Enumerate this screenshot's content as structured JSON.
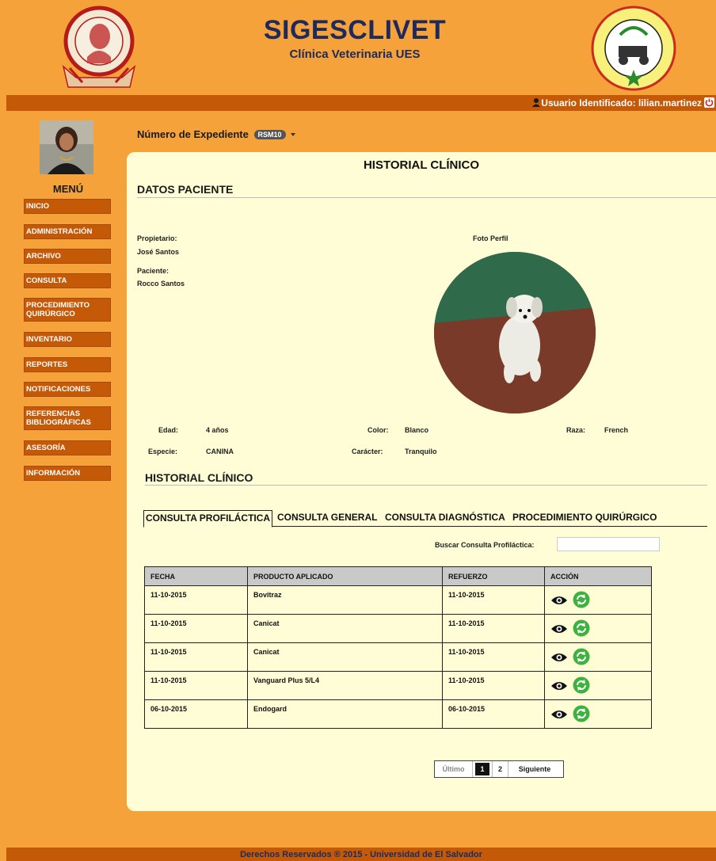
{
  "header": {
    "title": "SIGESCLIVET",
    "subtitle": "Clínica Veterinaria UES"
  },
  "user_bar": {
    "text": "Usuario Identificado: lilian.martinez"
  },
  "sidebar": {
    "menu_title": "MENÚ",
    "items": [
      {
        "label": "INICIO"
      },
      {
        "label": "ADMINISTRACIÓN"
      },
      {
        "label": "ARCHIVO"
      },
      {
        "label": "CONSULTA"
      },
      {
        "label": "PROCEDIMIENTO QUIRÚRGICO"
      },
      {
        "label": "INVENTARIO"
      },
      {
        "label": "REPORTES"
      },
      {
        "label": "NOTIFICACIONES"
      },
      {
        "label": "REFERENCIAS BIBLIOGRÁFICAS"
      },
      {
        "label": "ASESORÍA"
      },
      {
        "label": "INFORMACIÓN"
      }
    ]
  },
  "expediente": {
    "label": "Número de Expediente",
    "badge": "RSM10"
  },
  "main": {
    "title": "HISTORIAL CLÍNICO",
    "datos_title": "DATOS PACIENTE",
    "propietario_label": "Propietario:",
    "propietario_value": "José Santos",
    "paciente_label": "Paciente:",
    "paciente_value": "Rocco Santos",
    "foto_label": "Foto Perfil",
    "edad_label": "Edad:",
    "edad_value": "4 años",
    "color_label": "Color:",
    "color_value": "Blanco",
    "raza_label": "Raza:",
    "raza_value": "French",
    "especie_label": "Especie:",
    "especie_value": "CANINA",
    "caracter_label": "Carácter:",
    "caracter_value": "Tranquilo",
    "historial_title": "HISTORIAL CLÍNICO"
  },
  "tabs": [
    {
      "label": "CONSULTA PROFILÁCTICA"
    },
    {
      "label": "CONSULTA GENERAL"
    },
    {
      "label": "CONSULTA DIAGNÓSTICA"
    },
    {
      "label": "PROCEDIMIENTO QUIRÚRGICO"
    }
  ],
  "search": {
    "label": "Buscar Consulta Profiláctica:",
    "value": ""
  },
  "table": {
    "headers": [
      "FECHA",
      "PRODUCTO APLICADO",
      "REFUERZO",
      "ACCIÓN"
    ],
    "rows": [
      [
        "11-10-2015",
        "Bovitraz",
        "11-10-2015"
      ],
      [
        "11-10-2015",
        "Canicat",
        "11-10-2015"
      ],
      [
        "11-10-2015",
        "Canicat",
        "11-10-2015"
      ],
      [
        "11-10-2015",
        "Vanguard Plus 5/L4",
        "11-10-2015"
      ],
      [
        "06-10-2015",
        "Endogard",
        "06-10-2015"
      ]
    ]
  },
  "pagination": {
    "ultimo": "Último",
    "page1": "1",
    "page2": "2",
    "siguiente": "Siguiente"
  },
  "footer": {
    "text": "Derechos Reservados ® 2015 - Universidad de El Salvador"
  },
  "colors": {
    "background": "#f5a23a",
    "dark_orange": "#c45a08",
    "panel": "#fffdd6",
    "brand_navy": "#1c2a5e"
  },
  "icons": {
    "user": "user-icon",
    "power": "power-icon",
    "view": "eye-icon",
    "edit": "check-refresh-icon"
  }
}
